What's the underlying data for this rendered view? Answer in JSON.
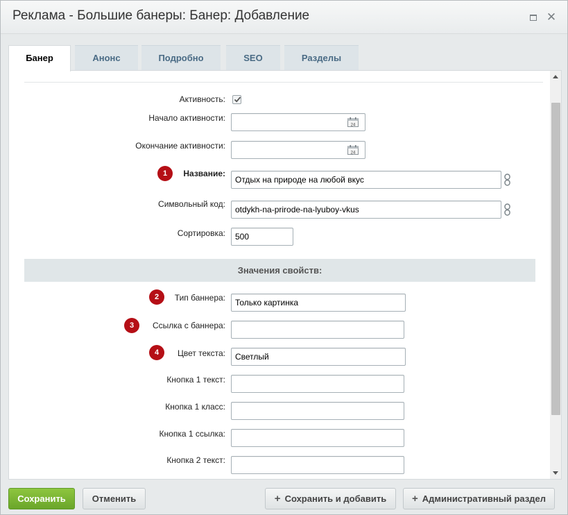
{
  "window": {
    "title": "Реклама - Большие банеры: Банер: Добавление"
  },
  "tabs": [
    {
      "label": "Банер",
      "active": true
    },
    {
      "label": "Анонс",
      "active": false
    },
    {
      "label": "Подробно",
      "active": false
    },
    {
      "label": "SEO",
      "active": false
    },
    {
      "label": "Разделы",
      "active": false
    }
  ],
  "form": {
    "active_label": "Активность:",
    "active_checked": true,
    "start_label": "Начало активности:",
    "start_value": "",
    "end_label": "Окончание активности:",
    "end_value": "",
    "calendar_day": "24",
    "name_label": "Название:",
    "name_value": "Отдых на природе на любой вкус",
    "code_label": "Символьный код:",
    "code_value": "otdykh-na-prirode-na-lyuboy-vkus",
    "sort_label": "Сортировка:",
    "sort_value": "500",
    "section_title": "Значения свойств:",
    "banner_type_label": "Тип баннера:",
    "banner_type_value": "Только картинка",
    "banner_link_label": "Ссылка с баннера:",
    "banner_link_value": "",
    "text_color_label": "Цвет текста:",
    "text_color_value": "Светлый",
    "btn1_text_label": "Кнопка 1 текст:",
    "btn1_text_value": "",
    "btn1_class_label": "Кнопка 1 класс:",
    "btn1_class_value": "",
    "btn1_link_label": "Кнопка 1 ссылка:",
    "btn1_link_value": "",
    "btn2_text_label": "Кнопка 2 текст:",
    "btn2_text_value": ""
  },
  "badges": [
    "1",
    "2",
    "3",
    "4"
  ],
  "footer": {
    "save": "Сохранить",
    "cancel": "Отменить",
    "save_add": "Сохранить и добавить",
    "admin": "Административный раздел"
  },
  "colors": {
    "badge": "#b50f16",
    "save_button": "#78b432",
    "tab_text": "#4a6b85"
  },
  "icons": {
    "calendar": "calendar-icon",
    "link": "link-icon",
    "checkbox": "checkmark-icon",
    "plus": "plus-icon"
  }
}
